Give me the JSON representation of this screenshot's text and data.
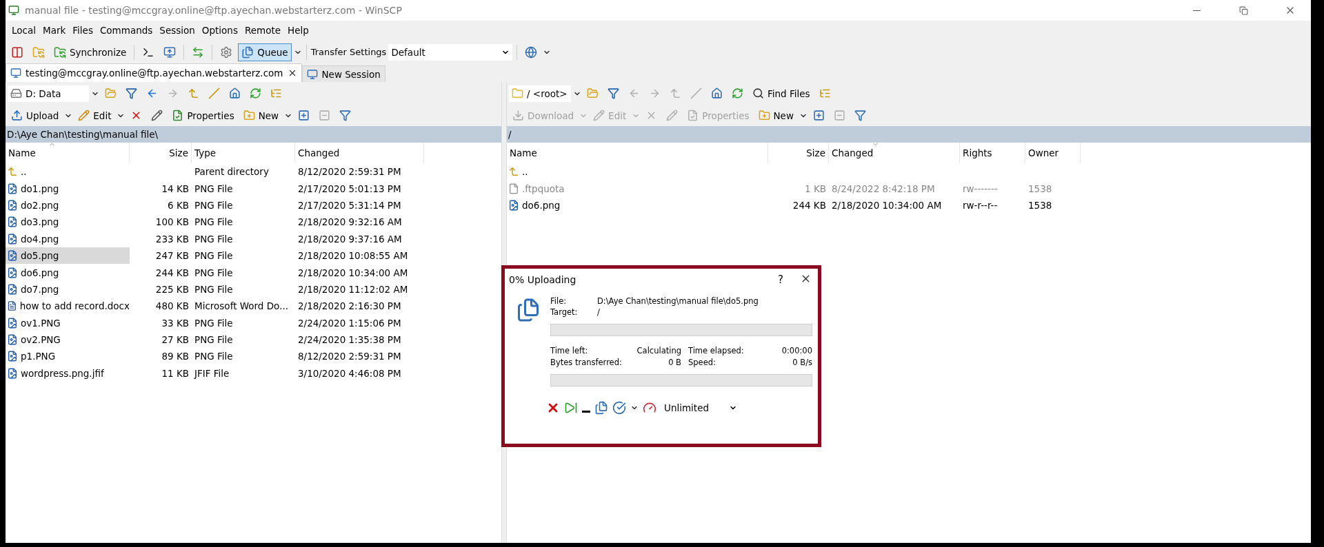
{
  "window": {
    "title": "manual file - testing@mccgray.online@ftp.ayechan.webstarterz.com - WinSCP"
  },
  "menu": [
    "Local",
    "Mark",
    "Files",
    "Commands",
    "Session",
    "Options",
    "Remote",
    "Help"
  ],
  "toolbar": {
    "synchronize": "Synchronize",
    "queue": {
      "label": "Queue",
      "pressed": true
    },
    "transfer_settings_label": "Transfer Settings",
    "transfer_settings_value": "Default"
  },
  "tabs": [
    {
      "label": "testing@mccgray.online@ftp.ayechan.webstarterz.com",
      "selected": true,
      "closable": true
    },
    {
      "label": "New Session",
      "selected": false,
      "closable": false
    }
  ],
  "left_panel": {
    "location": {
      "kind": "drive",
      "label": "D: Data"
    },
    "nav": [
      {
        "kind": "open",
        "disabled": false
      },
      {
        "kind": "filter",
        "disabled": false
      },
      {
        "kind": "back",
        "disabled": false
      },
      {
        "kind": "forward",
        "disabled": true
      },
      {
        "kind": "parent",
        "disabled": false
      },
      {
        "kind": "root",
        "disabled": false
      },
      {
        "kind": "home",
        "disabled": false
      },
      {
        "kind": "refresh",
        "disabled": false
      },
      {
        "kind": "tree",
        "disabled": false
      }
    ],
    "buttons": [
      {
        "kind": "upload",
        "label": "Upload",
        "disabled": false
      },
      {
        "kind": "edit",
        "label": "Edit",
        "disabled": false
      },
      {
        "kind": "delete",
        "disabled": false
      },
      {
        "kind": "rename",
        "disabled": false
      },
      {
        "kind": "properties",
        "label": "Properties",
        "disabled": false
      },
      {
        "kind": "new",
        "label": "New",
        "disabled": false
      },
      {
        "kind": "select",
        "disabled": false
      },
      {
        "kind": "unselect",
        "disabled": true
      },
      {
        "kind": "filter-mark",
        "disabled": false
      }
    ],
    "path": "D:\\Aye Chan\\testing\\manual file\\",
    "columns": [
      {
        "label": "Name",
        "kind": "text",
        "sorted_ascending": true,
        "sorted_descending": false
      },
      {
        "label": "Size",
        "kind": "number",
        "sorted_ascending": false,
        "sorted_descending": false
      },
      {
        "label": "Type",
        "kind": "text",
        "sorted_ascending": false,
        "sorted_descending": false
      },
      {
        "label": "Changed",
        "kind": "text",
        "sorted_ascending": false,
        "sorted_descending": false
      }
    ],
    "rows": [
      {
        "kind": "parent",
        "selected": false,
        "dimmed": false,
        "cells": [
          "..",
          "",
          "Parent directory",
          "8/12/2020 2:59:31 PM"
        ]
      },
      {
        "kind": "image",
        "selected": false,
        "dimmed": false,
        "cells": [
          "do1.png",
          "14 KB",
          "PNG File",
          "2/17/2020 5:01:13 PM"
        ]
      },
      {
        "kind": "image",
        "selected": false,
        "dimmed": false,
        "cells": [
          "do2.png",
          "6 KB",
          "PNG File",
          "2/17/2020 5:31:14 PM"
        ]
      },
      {
        "kind": "image",
        "selected": false,
        "dimmed": false,
        "cells": [
          "do3.png",
          "100 KB",
          "PNG File",
          "2/18/2020 9:32:16 AM"
        ]
      },
      {
        "kind": "image",
        "selected": false,
        "dimmed": false,
        "cells": [
          "do4.png",
          "233 KB",
          "PNG File",
          "2/18/2020 9:37:16 AM"
        ]
      },
      {
        "kind": "image",
        "selected": true,
        "dimmed": false,
        "cells": [
          "do5.png",
          "247 KB",
          "PNG File",
          "2/18/2020 10:08:55 AM"
        ]
      },
      {
        "kind": "image",
        "selected": false,
        "dimmed": false,
        "cells": [
          "do6.png",
          "244 KB",
          "PNG File",
          "2/18/2020 10:34:00 AM"
        ]
      },
      {
        "kind": "image",
        "selected": false,
        "dimmed": false,
        "cells": [
          "do7.png",
          "225 KB",
          "PNG File",
          "2/18/2020 11:12:02 AM"
        ]
      },
      {
        "kind": "word",
        "selected": false,
        "dimmed": false,
        "cells": [
          "how to add record.docx",
          "480 KB",
          "Microsoft Word Do...",
          "2/18/2020 2:16:30 PM"
        ]
      },
      {
        "kind": "image",
        "selected": false,
        "dimmed": false,
        "cells": [
          "ov1.PNG",
          "33 KB",
          "PNG File",
          "2/24/2020 1:15:06 PM"
        ]
      },
      {
        "kind": "image",
        "selected": false,
        "dimmed": false,
        "cells": [
          "ov2.PNG",
          "27 KB",
          "PNG File",
          "2/24/2020 1:35:38 PM"
        ]
      },
      {
        "kind": "image",
        "selected": false,
        "dimmed": false,
        "cells": [
          "p1.PNG",
          "89 KB",
          "PNG File",
          "8/12/2020 2:59:31 PM"
        ]
      },
      {
        "kind": "image",
        "selected": false,
        "dimmed": false,
        "cells": [
          "wordpress.png.jfif",
          "11 KB",
          "JFIF File",
          "3/10/2020 4:46:08 PM"
        ]
      }
    ]
  },
  "right_panel": {
    "location": {
      "kind": "folder",
      "label": "/ <root>"
    },
    "nav": [
      {
        "kind": "open",
        "disabled": false
      },
      {
        "kind": "filter",
        "disabled": false
      },
      {
        "kind": "back",
        "disabled": true
      },
      {
        "kind": "forward",
        "disabled": true
      },
      {
        "kind": "parent",
        "disabled": true
      },
      {
        "kind": "root",
        "disabled": true
      },
      {
        "kind": "home",
        "disabled": false
      },
      {
        "kind": "refresh",
        "disabled": false
      },
      {
        "kind": "find",
        "label": "Find Files",
        "disabled": false
      },
      {
        "kind": "tree",
        "disabled": false
      }
    ],
    "buttons": [
      {
        "kind": "download",
        "label": "Download",
        "disabled": true
      },
      {
        "kind": "edit",
        "label": "Edit",
        "disabled": true
      },
      {
        "kind": "delete",
        "disabled": true
      },
      {
        "kind": "rename",
        "disabled": true
      },
      {
        "kind": "properties",
        "label": "Properties",
        "disabled": true
      },
      {
        "kind": "new",
        "label": "New",
        "disabled": false
      },
      {
        "kind": "select",
        "disabled": false
      },
      {
        "kind": "unselect",
        "disabled": true
      },
      {
        "kind": "filter-mark",
        "disabled": false
      }
    ],
    "path": "/",
    "columns": [
      {
        "label": "Name",
        "kind": "text",
        "sorted_ascending": false,
        "sorted_descending": false
      },
      {
        "label": "Size",
        "kind": "number",
        "sorted_ascending": false,
        "sorted_descending": false
      },
      {
        "label": "Changed",
        "kind": "text",
        "sorted_ascending": false,
        "sorted_descending": true
      },
      {
        "label": "Rights",
        "kind": "text",
        "sorted_ascending": false,
        "sorted_descending": false
      },
      {
        "label": "Owner",
        "kind": "text",
        "sorted_ascending": false,
        "sorted_descending": false
      }
    ],
    "rows": [
      {
        "kind": "parent",
        "selected": false,
        "dimmed": false,
        "cells": [
          "..",
          "",
          "",
          "",
          ""
        ]
      },
      {
        "kind": "plain",
        "selected": false,
        "dimmed": true,
        "cells": [
          ".ftpquota",
          "1 KB",
          "8/24/2022 8:42:18 PM",
          "rw-------",
          "1538"
        ]
      },
      {
        "kind": "image",
        "selected": false,
        "dimmed": false,
        "cells": [
          "do6.png",
          "244 KB",
          "2/18/2020 10:34:00 AM",
          "rw-r--r--",
          "1538"
        ]
      }
    ]
  },
  "dialog": {
    "title": "0% Uploading",
    "help": "?",
    "file_label": "File:",
    "file_value": "D:\\Aye Chan\\testing\\manual file\\do5.png",
    "target_label": "Target:",
    "target_value": "/",
    "file_progress": {
      "level": 0
    },
    "stats": [
      {
        "label": "Time left:",
        "value": "Calculating"
      },
      {
        "label": "Time elapsed:",
        "value": "0:00:00"
      },
      {
        "label": "Bytes transferred:",
        "value": "0 B"
      },
      {
        "label": "Speed:",
        "value": "0 B/s"
      }
    ],
    "total_progress": {
      "level": 0
    },
    "speed_limit": "Unlimited"
  }
}
